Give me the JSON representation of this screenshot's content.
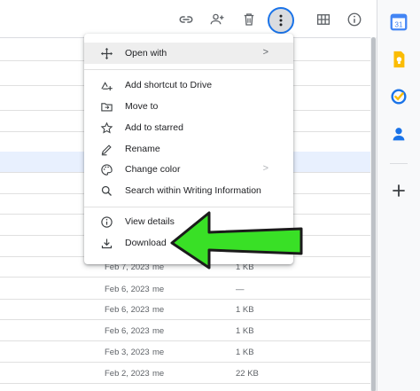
{
  "menu": {
    "open_with": "Open with",
    "add_shortcut": "Add shortcut to Drive",
    "move_to": "Move to",
    "add_starred": "Add to starred",
    "rename": "Rename",
    "change_color": "Change color",
    "search_within": "Search within Writing Information",
    "view_details": "View details",
    "download": "Download",
    "submenu_chevron": ">"
  },
  "files": {
    "rows": [
      {
        "date": "Feb 7, 2023",
        "owner": "me",
        "size": "1 KB"
      },
      {
        "date": "Feb 6, 2023",
        "owner": "me",
        "size": "—"
      },
      {
        "date": "Feb 6, 2023",
        "owner": "me",
        "size": "1 KB"
      },
      {
        "date": "Feb 6, 2023",
        "owner": "me",
        "size": "1 KB"
      },
      {
        "date": "Feb 3, 2023",
        "owner": "me",
        "size": "1 KB"
      },
      {
        "date": "Feb 2, 2023",
        "owner": "me",
        "size": "22 KB"
      }
    ]
  },
  "side_panel": {
    "calendar_day": "31"
  },
  "colors": {
    "accent_blue": "#1a73e8",
    "selected_row": "#e8f0fe",
    "arrow_green": "#39e026"
  },
  "icons": {
    "toolbar": [
      "link-icon",
      "add-person-icon",
      "trash-icon",
      "more-vert-icon",
      "grid-view-icon",
      "info-icon"
    ],
    "side": [
      "calendar-icon",
      "keep-icon",
      "tasks-icon",
      "contacts-icon",
      "add-icon"
    ]
  }
}
